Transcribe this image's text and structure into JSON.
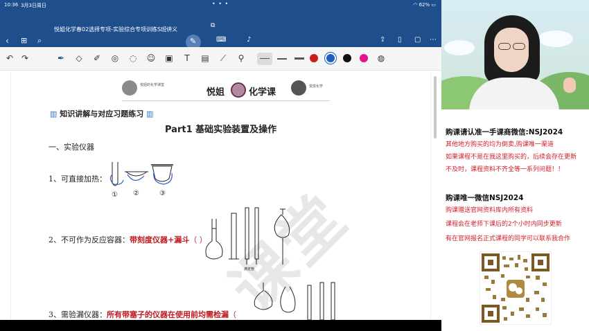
{
  "status": {
    "time": "10:36",
    "date": "3月3日周日",
    "battery": "62%"
  },
  "doc": {
    "title": "悦姐化学春02选择专项-实验综合专项训练S班讲义",
    "header": {
      "left_name": "悦姐的化学课堂",
      "right_name": "悦悦化学",
      "logo_a": "悦姐",
      "logo_b": "化学课"
    },
    "section_heading": "知识讲解与对应习题练习",
    "part_title": "Part1 基础实验装置及操作",
    "subheading": "一、实验仪器",
    "items": [
      {
        "label": "1、可直接加热：",
        "red": "",
        "tail": ""
      },
      {
        "label": "2、不可作为反应容器：",
        "red": "带刻度仪器+漏斗",
        "tail": "（                             ）"
      },
      {
        "label": "3、需验漏仪器：",
        "red": "所有带塞子的仪器在使用前均需检漏",
        "tail": "（"
      }
    ],
    "circles": [
      "①",
      "②",
      "③"
    ],
    "burette_label": "滴定管",
    "watermark": "课堂"
  },
  "colors": {
    "brand": "#1f4e8c",
    "toolbar_bg": "#f5f5f5",
    "ink_red": "#c0181e",
    "swatch_red": "#c81e1e",
    "swatch_blue": "#1f5fbf",
    "swatch_black": "#111111",
    "swatch_pink": "#e6148c"
  },
  "toolbar_icons": [
    "undo-icon",
    "redo-icon",
    "pen-icon",
    "eraser-icon",
    "highlighter-icon",
    "shape-icon",
    "lasso-icon",
    "sticker-icon",
    "image-icon",
    "text-icon",
    "ruler-icon",
    "laser-icon",
    "line-icon"
  ],
  "ad": {
    "head1": "购课请认准一手课商微信:NSJ2024",
    "lines1": [
      "其他地方购买的均为倒卖,购课唯一渠道",
      "如果课程不是在我这里购买的，后续会存在更新",
      "不及时，课程资料不齐全等一系列问题！！"
    ],
    "head2": "购课唯一微信NSJ2024",
    "lines2": [
      "购课赠送官网资料库内所有资料",
      "课程会在老师下课后的2个小时内同步更新",
      "有在官网报名正式课程的同学可以联系我合作"
    ]
  }
}
